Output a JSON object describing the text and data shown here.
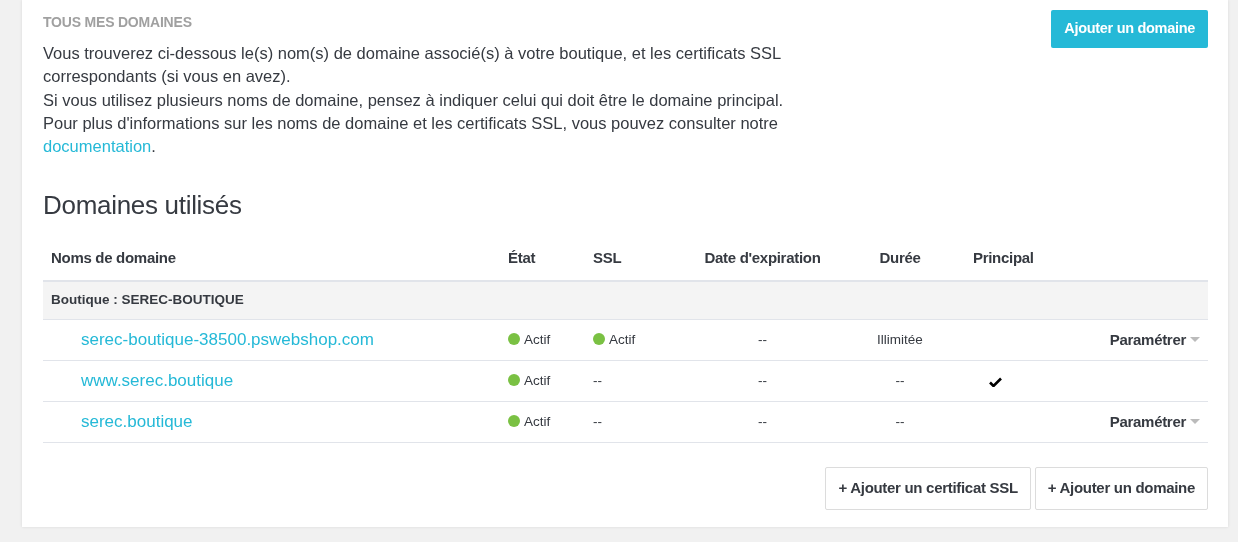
{
  "panel": {
    "title": "TOUS MES DOMAINES",
    "add_button": "Ajouter un domaine",
    "paragraphs": [
      {
        "text": "Vous trouverez ci-dessous le(s) nom(s) de domaine associé(s) à votre boutique, et les certificats SSL correspondants (si vous en avez)."
      },
      {
        "text": "Si vous utilisez plusieurs noms de domaine, pensez à indiquer celui qui doit être le domaine principal."
      },
      {
        "text": "Pour plus d'informations sur les noms de domaine et les certificats SSL, vous pouvez consulter notre ",
        "link": "documentation",
        "after": "."
      }
    ]
  },
  "section_title": "Domaines utilisés",
  "table": {
    "columns": [
      "Noms de domaine",
      "État",
      "SSL",
      "Date d'expiration",
      "Durée",
      "Principal"
    ],
    "group": "Boutique : SEREC-BOUTIQUE",
    "rows": [
      {
        "domain": "serec-boutique-38500.pswebshop.com",
        "state": {
          "text": "Actif",
          "color": "#7ac143"
        },
        "ssl": {
          "text": "Actif",
          "color": "#7ac143"
        },
        "expiration": "--",
        "duration": "Illimitée",
        "principal": false,
        "action": "Paramétrer"
      },
      {
        "domain": "www.serec.boutique",
        "state": {
          "text": "Actif",
          "color": "#7ac143"
        },
        "ssl": {
          "text": "--"
        },
        "expiration": "--",
        "duration": "--",
        "principal": true
      },
      {
        "domain": "serec.boutique",
        "state": {
          "text": "Actif",
          "color": "#7ac143"
        },
        "ssl": {
          "text": "--"
        },
        "expiration": "--",
        "duration": "--",
        "principal": false,
        "action": "Paramétrer"
      }
    ]
  },
  "footer_buttons": [
    "+ Ajouter un certificat SSL",
    "+ Ajouter un domaine"
  ]
}
